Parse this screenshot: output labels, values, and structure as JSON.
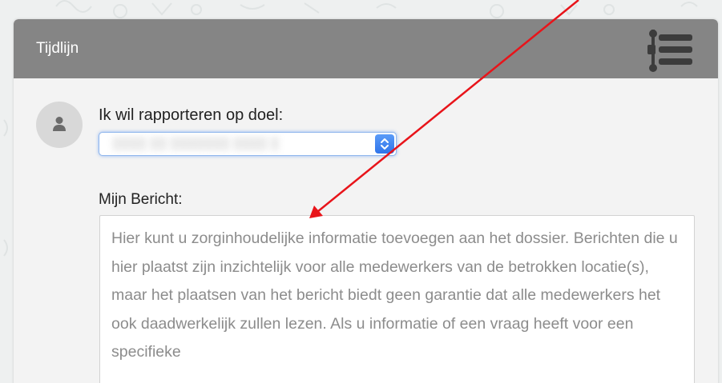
{
  "header": {
    "title": "Tijdlijn",
    "icon": "timeline-icon"
  },
  "form": {
    "avatar_icon": "user-icon",
    "goal_label": "Ik wil rapporteren op doel:",
    "goal_select_value": "░░░░ ░░ ░░░░░░░ ░░░░ ░",
    "message_label": "Mijn Bericht:",
    "message_placeholder": "Hier kunt u zorginhoudelijke informatie toevoegen aan het dossier. Berichten die u hier plaatst zijn inzichtelijk voor alle medewerkers van de betrokken locatie(s), maar het plaatsen van het bericht biedt geen garantie dat alle medewerkers het ook daadwerkelijk zullen lezen. Als u informatie of een vraag heeft voor een specifieke"
  },
  "colors": {
    "header_bg": "#858585",
    "accent_blue": "#3b82f6",
    "annotation_red": "#e8141a"
  }
}
